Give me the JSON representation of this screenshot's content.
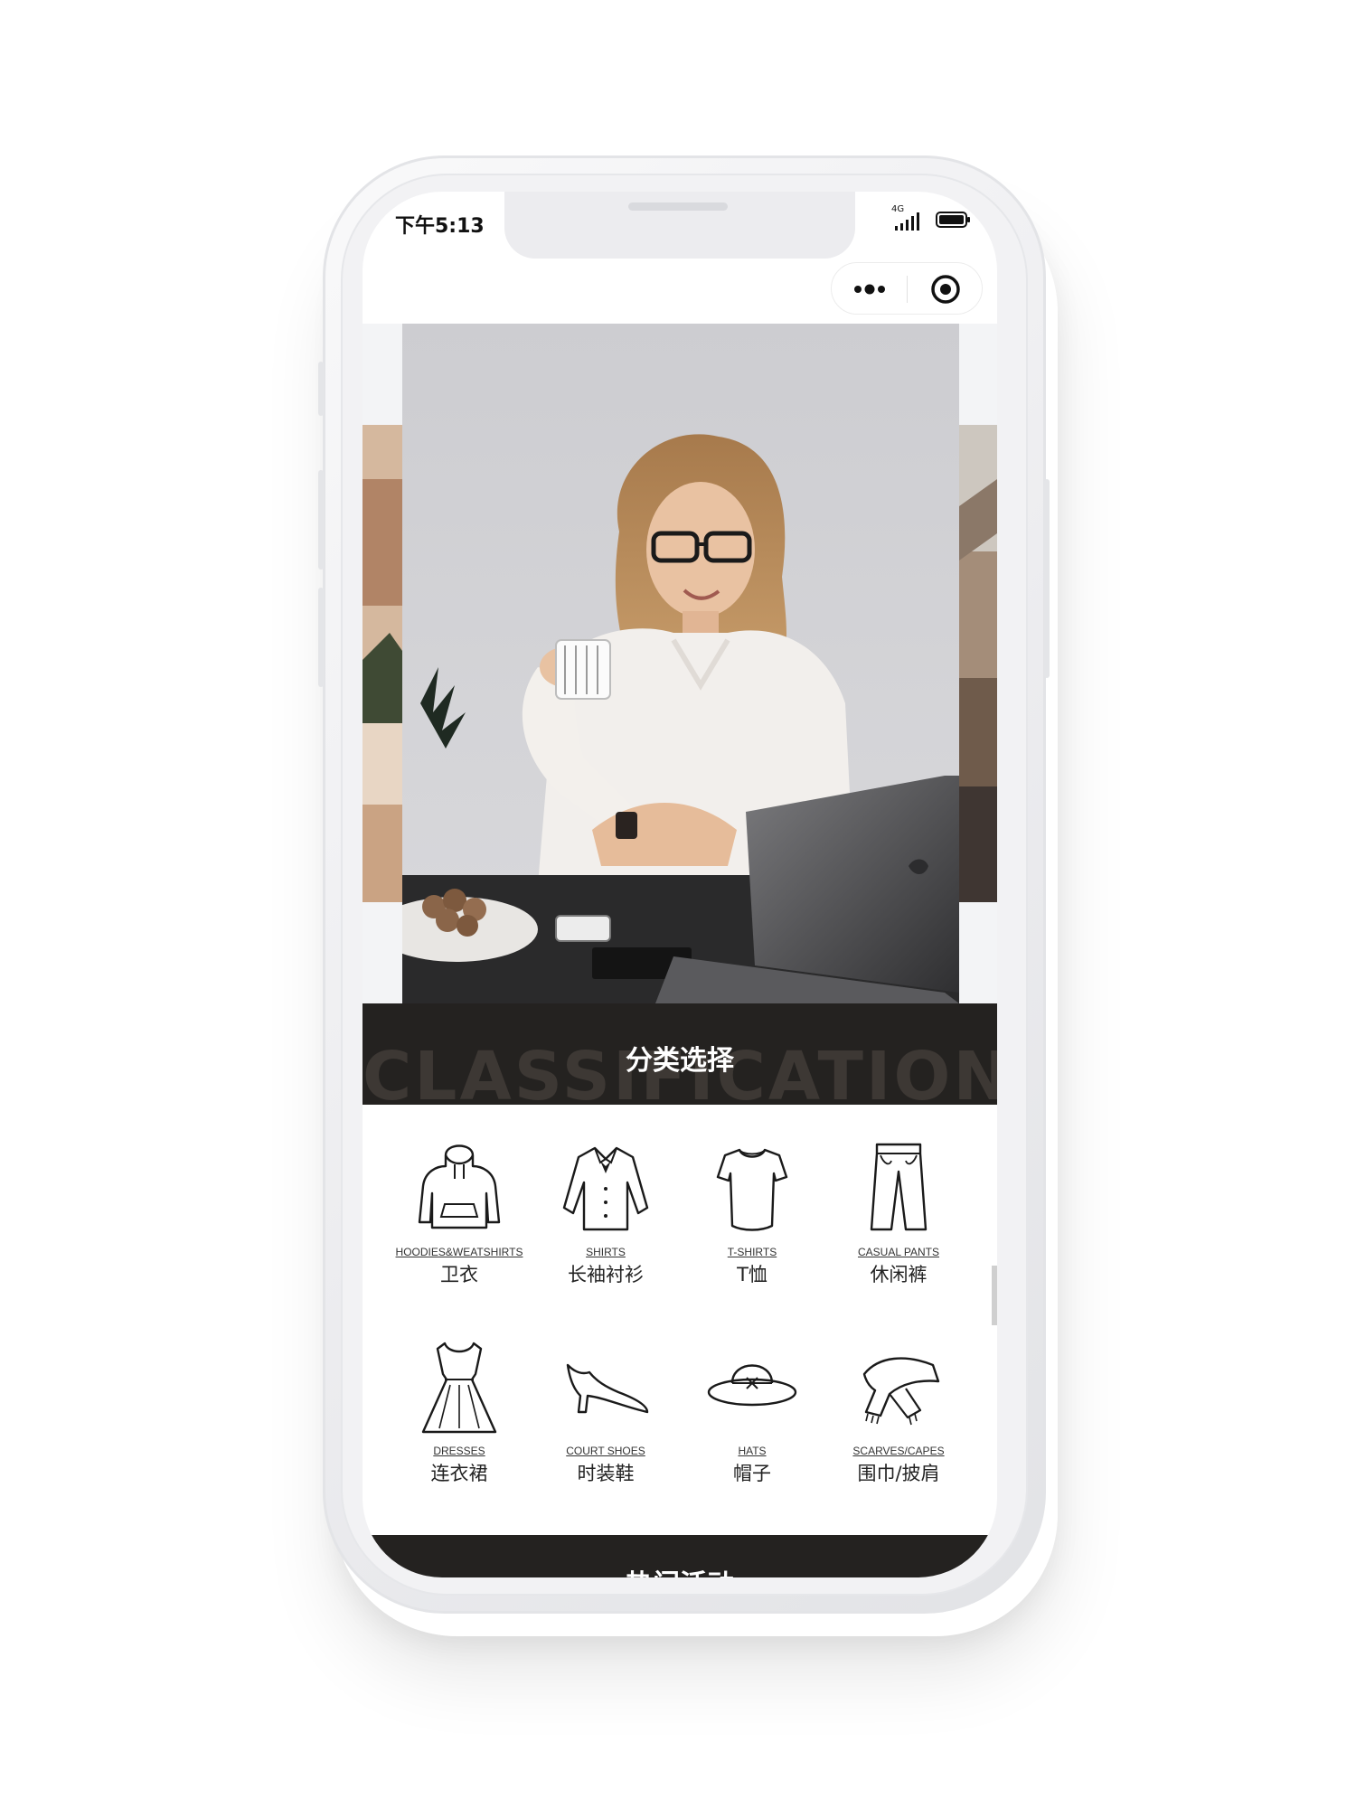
{
  "status_bar": {
    "time": "下午5:13",
    "network": "4G"
  },
  "capsule": {
    "more_icon": "more-dots-icon",
    "close_icon": "target-circle-icon"
  },
  "carousel": {
    "slides": [
      "left-partial",
      "main",
      "right-partial"
    ]
  },
  "classification": {
    "title": "分类选择",
    "background_text": "CLASSIFICATION",
    "banner_color": "#242220"
  },
  "categories": [
    {
      "en": "HOODIES&WEATSHIRTS",
      "cn": "卫衣",
      "icon": "hoodie-icon"
    },
    {
      "en": "SHIRTS",
      "cn": "长袖衬衫",
      "icon": "shirt-icon"
    },
    {
      "en": "T-SHIRTS",
      "cn": "T恤",
      "icon": "tshirt-icon"
    },
    {
      "en": "CASUAL PANTS",
      "cn": "休闲裤",
      "icon": "pants-icon"
    },
    {
      "en": "DRESSES",
      "cn": "连衣裙",
      "icon": "dress-icon"
    },
    {
      "en": "COURT SHOES",
      "cn": "时装鞋",
      "icon": "heel-shoe-icon"
    },
    {
      "en": "HATS",
      "cn": "帽子",
      "icon": "hat-icon"
    },
    {
      "en": "SCARVES/CAPES",
      "cn": "围巾/披肩",
      "icon": "scarf-icon"
    }
  ],
  "hot_section": {
    "title": "热门活动"
  }
}
